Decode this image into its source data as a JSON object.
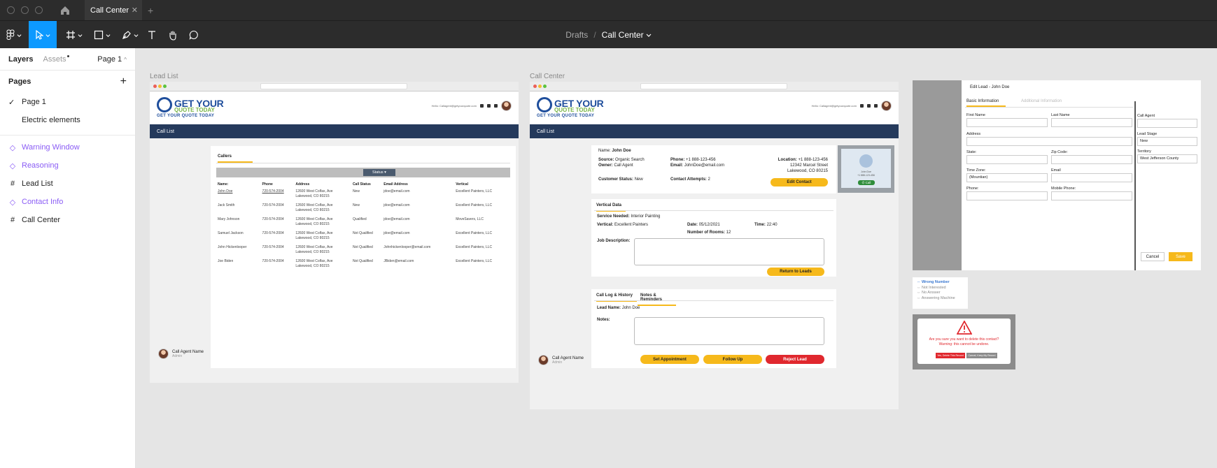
{
  "window": {
    "tab_title": "Call Center"
  },
  "toolbar": {
    "breadcrumb_parent": "Drafts",
    "breadcrumb_sep": "/",
    "breadcrumb_current": "Call Center"
  },
  "left_panel": {
    "tab_layers": "Layers",
    "tab_assets": "Assets",
    "page_selector": "Page 1",
    "pages_heading": "Pages",
    "pages": [
      "Page 1",
      "Electric elements"
    ],
    "layers": [
      {
        "name": "Warning Window",
        "kind": "component"
      },
      {
        "name": "Reasoning",
        "kind": "component"
      },
      {
        "name": "Lead List",
        "kind": "frame"
      },
      {
        "name": "Contact Info",
        "kind": "component"
      },
      {
        "name": "Call Center",
        "kind": "frame"
      }
    ]
  },
  "frames": {
    "lead_list_label": "Lead List",
    "call_center_label": "Call Center"
  },
  "brand": {
    "logo_l1a": "GET YOUR",
    "logo_l2": "QUOTE TODAY",
    "logo_tagline": "GET YOUR QUOTE TODAY",
    "greeting": "Hello: Callagent@getyourquote.com",
    "accent": "#f6b91b",
    "nav_color": "#253a5c"
  },
  "lead_list": {
    "nav": "Call List",
    "tab": "Callers",
    "status_button": "Status",
    "columns": [
      "Name:",
      "Phone",
      "Address",
      "Call Status",
      "Email  Address",
      "Vertical"
    ],
    "rows": [
      [
        "John Doe",
        "720-574-2004",
        "12600 West Colfax, Ave\nLakewood, CO 80215",
        "New",
        "jdoe@email.com",
        "Excellent Painters, LLC"
      ],
      [
        "Jack Smith",
        "720-574-2004",
        "12600 West Colfax, Ave\nLakewood, CO 80215",
        "New",
        "jdoe@email.com",
        "Excellent Painters, LLC"
      ],
      [
        "Mary Johnson",
        "720-574-2004",
        "12600 West Colfax, Ave\nLakewood, CO 80215",
        "Qualified",
        "jdoe@email.com",
        "MoveSavers, LLC"
      ],
      [
        "Samuel Jackson",
        "720-574-2004",
        "12600 West Colfax, Ave\nLakewood, CO 80215",
        "Not Qualified",
        "jdoe@email.com",
        "Excellent Painters, LLC"
      ],
      [
        "John Hickenlooper",
        "720-574-2004",
        "12600 West Colfax, Ave\nLakewood, CO 80215",
        "Not Qualified",
        "Johnhickenlooper@email.com",
        "Excellent Painters, LLC"
      ],
      [
        "Joe Biden",
        "720-574-2004",
        "12600 West Colfax, Ave\nLakewood, CO 80215",
        "Not Qualified",
        "JBiden@email.com",
        "Excellent Painters, LLC"
      ]
    ],
    "agent_name": "Call Agent Name",
    "agent_role": "Admin"
  },
  "call_center": {
    "nav": "Call List",
    "name_label": "Name:",
    "name_value": "John Doe",
    "source_label": "Source:",
    "source_value": "Organic Search",
    "owner_label": "Owner:",
    "owner_value": "Call Agent",
    "phone_label": "Phone:",
    "phone_value": "+1 888-123-456",
    "email_label": "Email:",
    "email_value": "JohnDoe@email.com",
    "location_label": "Location:",
    "location_value": "+1 888-123-456",
    "location_line2": "12342 Marcel Street",
    "location_line3": "Lakewood, CO 80215",
    "customer_status_label": "Customer Status:",
    "customer_status_value": "New",
    "contact_attempts_label": "Contact Attempts:",
    "contact_attempts_value": "2",
    "edit_contact": "Edit Contact",
    "phone_caption": "John Doe",
    "phone_caption2": "+1 888-123-456",
    "call_button": "Call",
    "vertical_tab": "Vertical Data",
    "service_label": "Service Needed:",
    "service_value": "Interior Painting",
    "vertical_label": "Vertical:",
    "vertical_value": "Excellent Painters",
    "date_label": "Date:",
    "date_value": "05/12/2021",
    "time_label": "Time:",
    "time_value": "22:40",
    "rooms_label": "Number of Rooms:",
    "rooms_value": "12",
    "job_desc_label": "Job Description:",
    "return_button": "Return to Leads",
    "tab_call_log": "Call  Log & History",
    "tab_notes": "Notes & Reminders",
    "lead_name_label": "Lead Name:",
    "lead_name_value": "John Doe",
    "notes_label": "Notes:",
    "btn_set_appt": "Set Appointment",
    "btn_follow_up": "Follow Up",
    "btn_reject": "Reject Lead",
    "agent_name": "Call Agent Name",
    "agent_role": "Admin"
  },
  "edit_lead": {
    "title": "Edit Lead - John Doe",
    "tab_basic": "Basic Information",
    "tab_additional": "Additional Information",
    "first_name": "First Name",
    "last_name": "Last Name",
    "address": "Address",
    "state": "State:",
    "zip": "Zip Code:",
    "timezone": "Time Zone:",
    "timezone_value": "(Mountian)",
    "email": "Email",
    "phone": "Phone:",
    "mobile": "Mobile Phone:",
    "call_agent": "Call Agent",
    "lead_stage": "Lead Stage",
    "lead_stage_value": "New",
    "territory": "Territory",
    "territory_value": "West Jefferson County",
    "cancel": "Cancel",
    "save": "Save"
  },
  "dropdown": {
    "options": [
      "Wrong Number",
      "Not Interested",
      "No Answer",
      "Answering Machine"
    ]
  },
  "delete_dialog": {
    "line1": "Are you sure you want to delete this contact?",
    "line2": "Warning: this cannot be undone.",
    "btn_yes": "Yes, Delete This Record",
    "btn_no": "Cancel, Keep My Record"
  }
}
